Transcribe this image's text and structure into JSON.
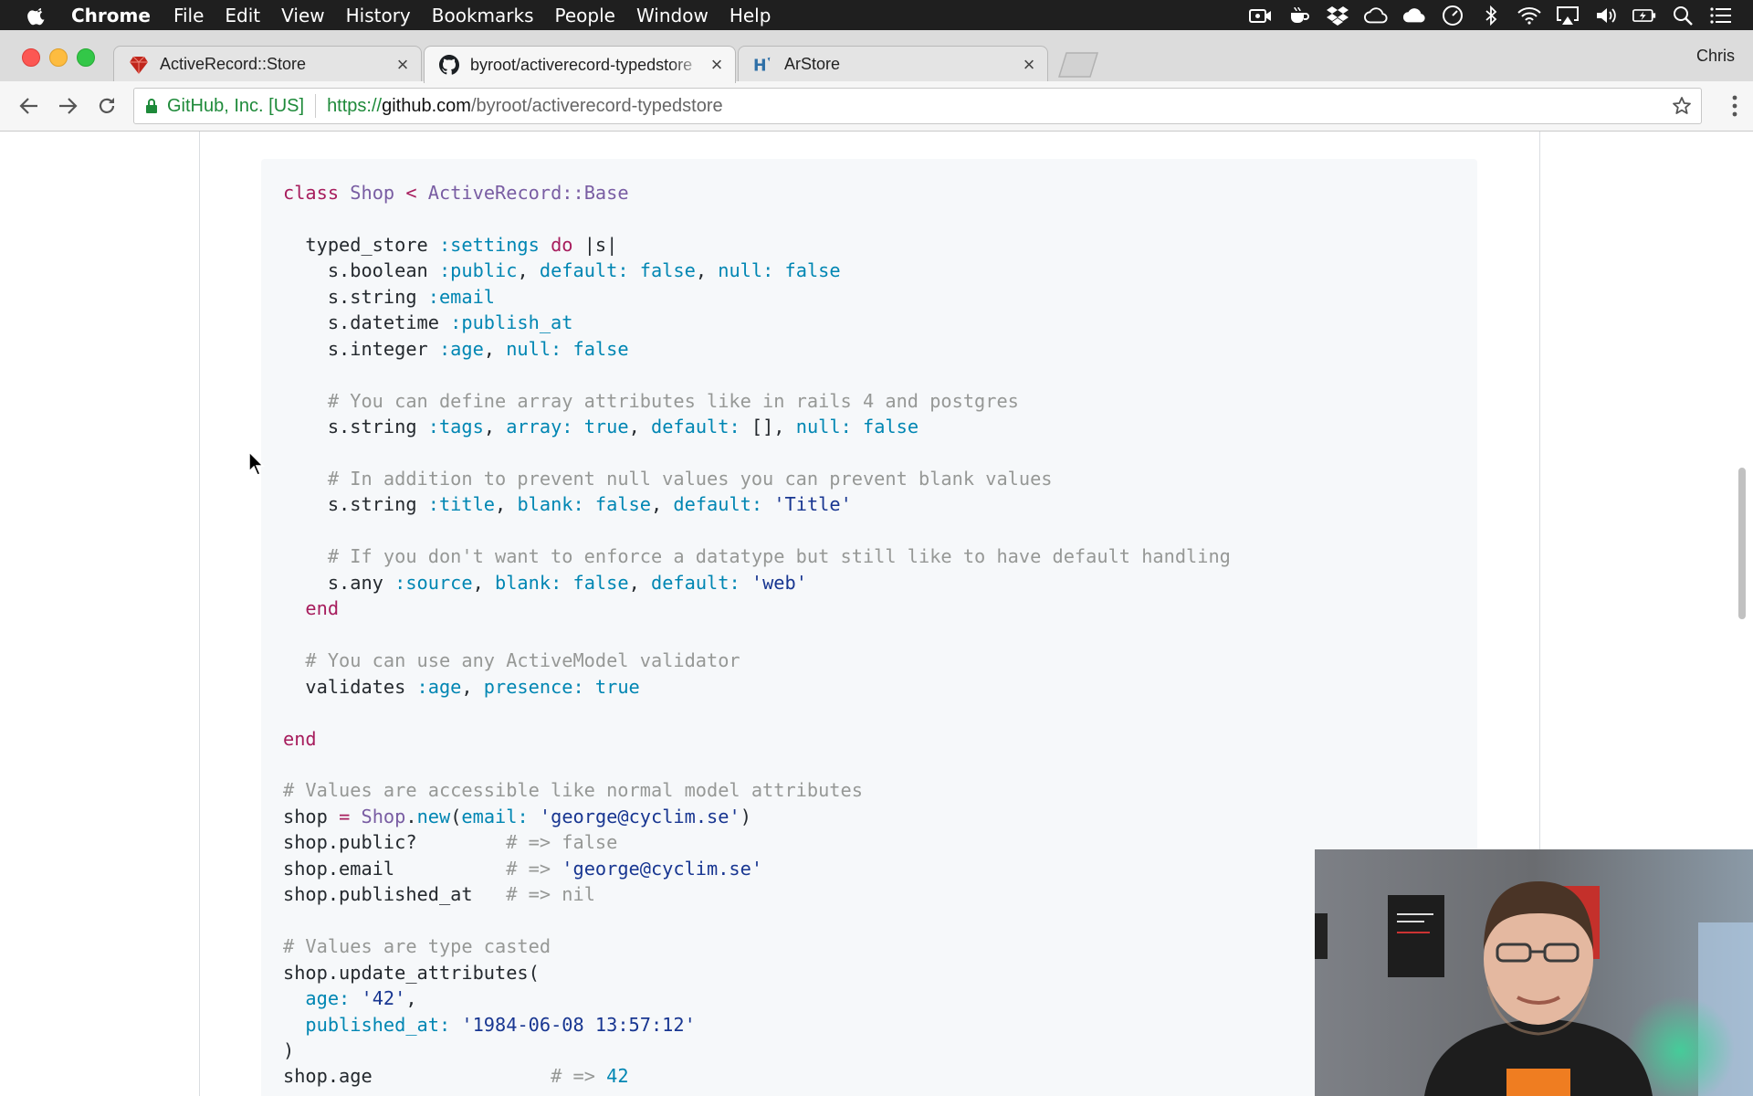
{
  "menubar": {
    "app": "Chrome",
    "items": [
      "File",
      "Edit",
      "View",
      "History",
      "Bookmarks",
      "People",
      "Window",
      "Help"
    ]
  },
  "tabs": [
    {
      "title": "ActiveRecord::Store",
      "icon": "ruby-icon"
    },
    {
      "title": "byroot/activerecord-typedstore",
      "icon": "github-icon"
    },
    {
      "title": "ArStore",
      "icon": "hashrocket-icon"
    }
  ],
  "profile": "Chris",
  "address": {
    "ev_label": "GitHub, Inc. [US]",
    "scheme": "https://",
    "host": "github.com",
    "path": "/byroot/activerecord-typedstore"
  },
  "colors": {
    "keyword": "#a71d5d",
    "comment": "#969896",
    "string": "#183691",
    "symbol": "#0086b3",
    "constant": "#795da3",
    "ev_green": "#1e8a3a"
  },
  "code": {
    "lines": [
      "class Shop < ActiveRecord::Base",
      "",
      "  typed_store :settings do |s|",
      "    s.boolean :public, default: false, null: false",
      "    s.string :email",
      "    s.datetime :publish_at",
      "    s.integer :age, null: false",
      "",
      "    # You can define array attributes like in rails 4 and postgres",
      "    s.string :tags, array: true, default: [], null: false",
      "",
      "    # In addition to prevent null values you can prevent blank values",
      "    s.string :title, blank: false, default: 'Title'",
      "",
      "    # If you don't want to enforce a datatype but still like to have default handling",
      "    s.any :source, blank: false, default: 'web'",
      "  end",
      "",
      "  # You can use any ActiveModel validator",
      "  validates :age, presence: true",
      "",
      "end",
      "",
      "# Values are accessible like normal model attributes",
      "shop = Shop.new(email: 'george@cyclim.se')",
      "shop.public?        # => false",
      "shop.email          # => 'george@cyclim.se'",
      "shop.published_at   # => nil",
      "",
      "# Values are type casted",
      "shop.update_attributes(",
      "  age: '42',",
      "  published_at: '1984-06-08 13:57:12'",
      ")",
      "shop.age                # => 42"
    ]
  }
}
